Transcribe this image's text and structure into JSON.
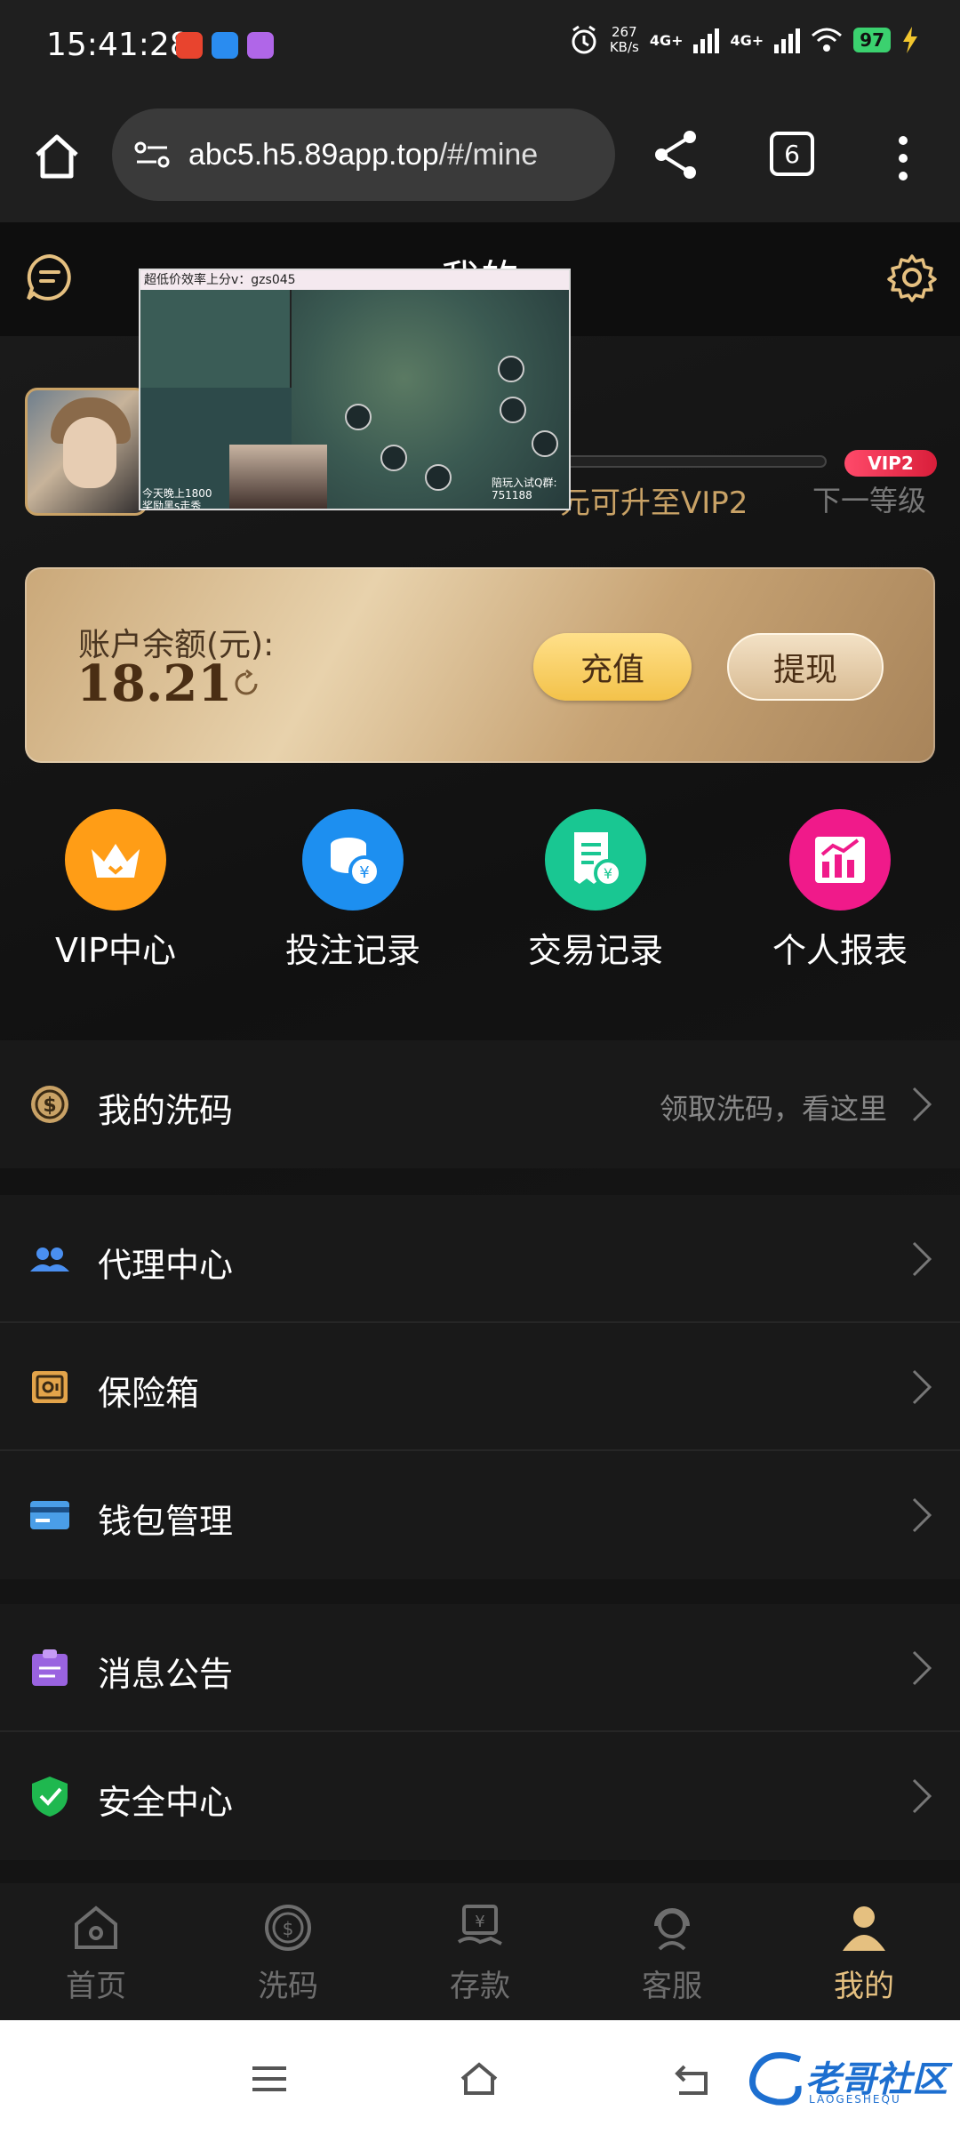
{
  "status_bar": {
    "time": "15:41:28",
    "net_speed": "267",
    "net_speed_unit": "KB/s",
    "sim1": "4G+",
    "sim2": "4G+",
    "battery": "97"
  },
  "browser": {
    "url_host": "abc5.h5.89app.top",
    "url_path": "/#/mine",
    "tab_count": "6"
  },
  "header": {
    "title": "我的"
  },
  "profile": {
    "vip_badge": "VIP2",
    "upgrade_text": "元可升至VIP2",
    "next_level_label": "下一等级"
  },
  "video_overlay": {
    "top_text": "超低价效率上分v：gzs045",
    "caption_line1": "今天晚上1800",
    "caption_line2": "奖励黑s走秀",
    "qq_line1": "陪玩入试Q群:",
    "qq_line2": "751188"
  },
  "balance": {
    "label": "账户余额(元):",
    "value": "18.21",
    "recharge": "充值",
    "withdraw": "提现"
  },
  "quick_actions": [
    {
      "label": "VIP中心",
      "color": "#ff9d16"
    },
    {
      "label": "投注记录",
      "color": "#1d8ff0"
    },
    {
      "label": "交易记录",
      "color": "#19c792"
    },
    {
      "label": "个人报表",
      "color": "#f01a8a"
    }
  ],
  "menu": {
    "rebate": {
      "label": "我的洗码",
      "hint": "领取洗码，看这里"
    },
    "agent": {
      "label": "代理中心"
    },
    "safe": {
      "label": "保险箱"
    },
    "wallet": {
      "label": "钱包管理"
    },
    "notice": {
      "label": "消息公告"
    },
    "security": {
      "label": "安全中心"
    }
  },
  "bottom_nav": [
    {
      "label": "首页",
      "icon": "home-icon"
    },
    {
      "label": "洗码",
      "icon": "coin-icon"
    },
    {
      "label": "存款",
      "icon": "deposit-icon"
    },
    {
      "label": "客服",
      "icon": "support-icon"
    },
    {
      "label": "我的",
      "icon": "user-icon",
      "active": true
    }
  ],
  "watermark": {
    "text": "老哥社区",
    "sub": "LAOGESHEQU"
  },
  "colors": {
    "gold": "#c9a266",
    "active_nav": "#e5c080",
    "background": "#141414"
  }
}
